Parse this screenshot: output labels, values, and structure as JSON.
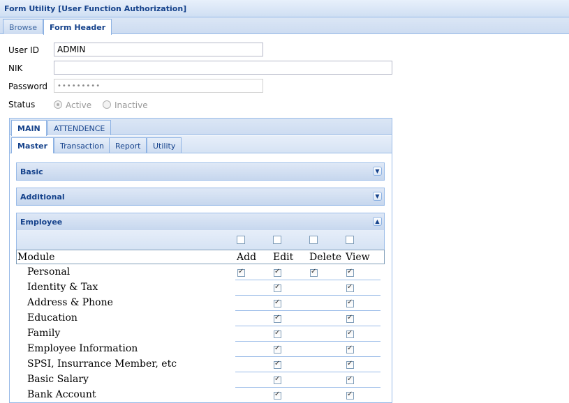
{
  "window": {
    "title": "Form Utility [User Function Authorization]"
  },
  "tabs": [
    {
      "label": "Browse"
    },
    {
      "label": "Form Header"
    }
  ],
  "form": {
    "user_id_label": "User ID",
    "user_id_value": "ADMIN",
    "nik_label": "NIK",
    "nik_value": "",
    "password_label": "Password",
    "password_value": "•••••••••",
    "status_label": "Status",
    "status_options": [
      {
        "label": "Active",
        "selected": true
      },
      {
        "label": "Inactive",
        "selected": false
      }
    ]
  },
  "main_tabs": [
    {
      "label": "MAIN"
    },
    {
      "label": "ATTENDENCE"
    }
  ],
  "sub_tabs": [
    {
      "label": "Master"
    },
    {
      "label": "Transaction"
    },
    {
      "label": "Report"
    },
    {
      "label": "Utility"
    }
  ],
  "sections": [
    {
      "title": "Basic",
      "collapsed": true
    },
    {
      "title": "Additional",
      "collapsed": true
    },
    {
      "title": "Employee",
      "collapsed": false
    }
  ],
  "grid": {
    "columns": [
      "Module",
      "Add",
      "Edit",
      "Delete",
      "View"
    ],
    "rows": [
      {
        "module": "Personal",
        "add": true,
        "edit": true,
        "delete": true,
        "view": true
      },
      {
        "module": "Identity & Tax",
        "add": null,
        "edit": true,
        "delete": null,
        "view": true
      },
      {
        "module": "Address & Phone",
        "add": null,
        "edit": true,
        "delete": null,
        "view": true
      },
      {
        "module": "Education",
        "add": null,
        "edit": true,
        "delete": null,
        "view": true
      },
      {
        "module": "Family",
        "add": null,
        "edit": true,
        "delete": null,
        "view": true
      },
      {
        "module": "Employee Information",
        "add": null,
        "edit": true,
        "delete": null,
        "view": true
      },
      {
        "module": "SPSI, Insurrance Member, etc",
        "add": null,
        "edit": true,
        "delete": null,
        "view": true
      },
      {
        "module": "Basic Salary",
        "add": null,
        "edit": true,
        "delete": null,
        "view": true
      },
      {
        "module": "Bank Account",
        "add": null,
        "edit": true,
        "delete": null,
        "view": true
      }
    ]
  }
}
